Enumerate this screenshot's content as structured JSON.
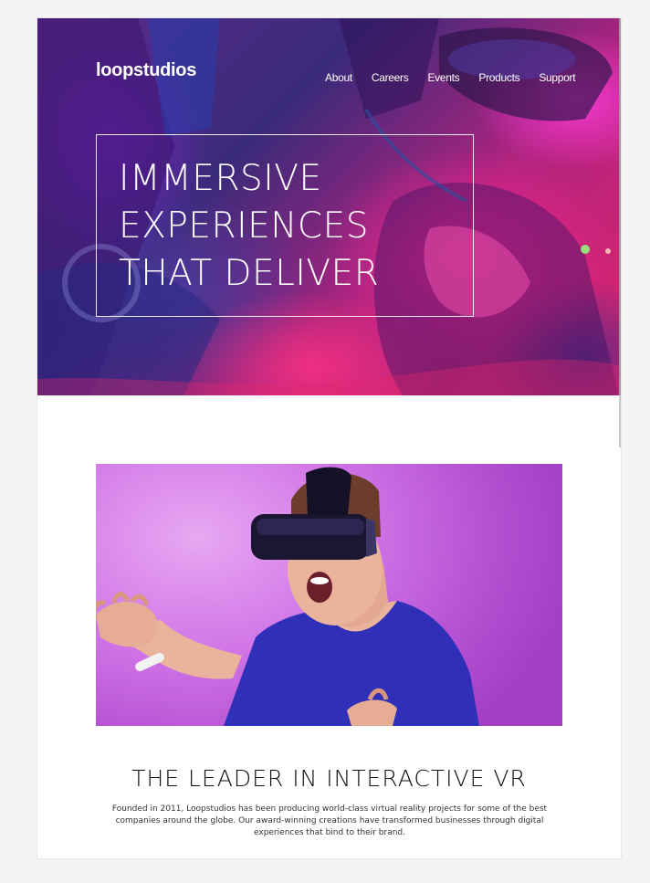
{
  "header": {
    "logo": "loopstudios",
    "nav": [
      {
        "label": "About"
      },
      {
        "label": "Careers"
      },
      {
        "label": "Events"
      },
      {
        "label": "Products"
      },
      {
        "label": "Support"
      }
    ]
  },
  "hero": {
    "title": "IMMERSIVE\nEXPERIENCES\nTHAT DELIVER"
  },
  "interactive": {
    "image_alt": "man-wearing-vr-headset",
    "title": "THE LEADER IN INTERACTIVE VR",
    "text": "Founded in 2011, Loopstudios has been producing world-class virtual reality projects for some of the best companies around the globe. Our award-winning creations have transformed businesses through digital experiences that bind to their brand."
  },
  "colors": {
    "page_background": "#f4f4f4",
    "content_background": "#ffffff",
    "text_dark": "#111111",
    "hero_white": "#ffffff",
    "vr_background": "#cf72e6",
    "shirt_blue": "#2a2aa8"
  }
}
